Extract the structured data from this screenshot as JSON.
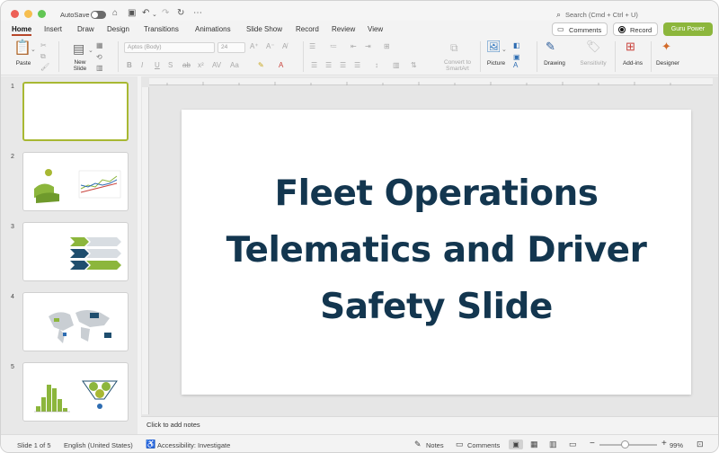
{
  "titlebar": {
    "autosave_label": "AutoSave",
    "search_placeholder": "Search (Cmd + Ctrl + U)"
  },
  "tabs": [
    "Home",
    "Insert",
    "Draw",
    "Design",
    "Transitions",
    "Animations",
    "Slide Show",
    "Record",
    "Review",
    "View"
  ],
  "header_buttons": {
    "comments": "Comments",
    "record": "Record",
    "guru": "Guru Power"
  },
  "ribbon": {
    "paste": "Paste",
    "new_slide": "New Slide",
    "font_name": "Aptos (Body)",
    "font_size": "24",
    "convert_smartart": "Convert to SmartArt",
    "picture": "Picture",
    "drawing": "Drawing",
    "sensitivity": "Sensitivity",
    "addins": "Add-ins",
    "designer": "Designer"
  },
  "slides": {
    "numbers": [
      "1",
      "2",
      "3",
      "4",
      "5"
    ],
    "current_title": "Fleet Operations Telematics and Driver Safety Slide"
  },
  "notes_placeholder": "Click to add notes",
  "statusbar": {
    "slide_count": "Slide 1 of 5",
    "language": "English (United States)",
    "accessibility": "Accessibility: Investigate",
    "notes": "Notes",
    "comments": "Comments",
    "zoom": "99%"
  },
  "colors": {
    "accent_green": "#8cb63c",
    "title_navy": "#13364f",
    "tab_underline": "#b7472a"
  }
}
